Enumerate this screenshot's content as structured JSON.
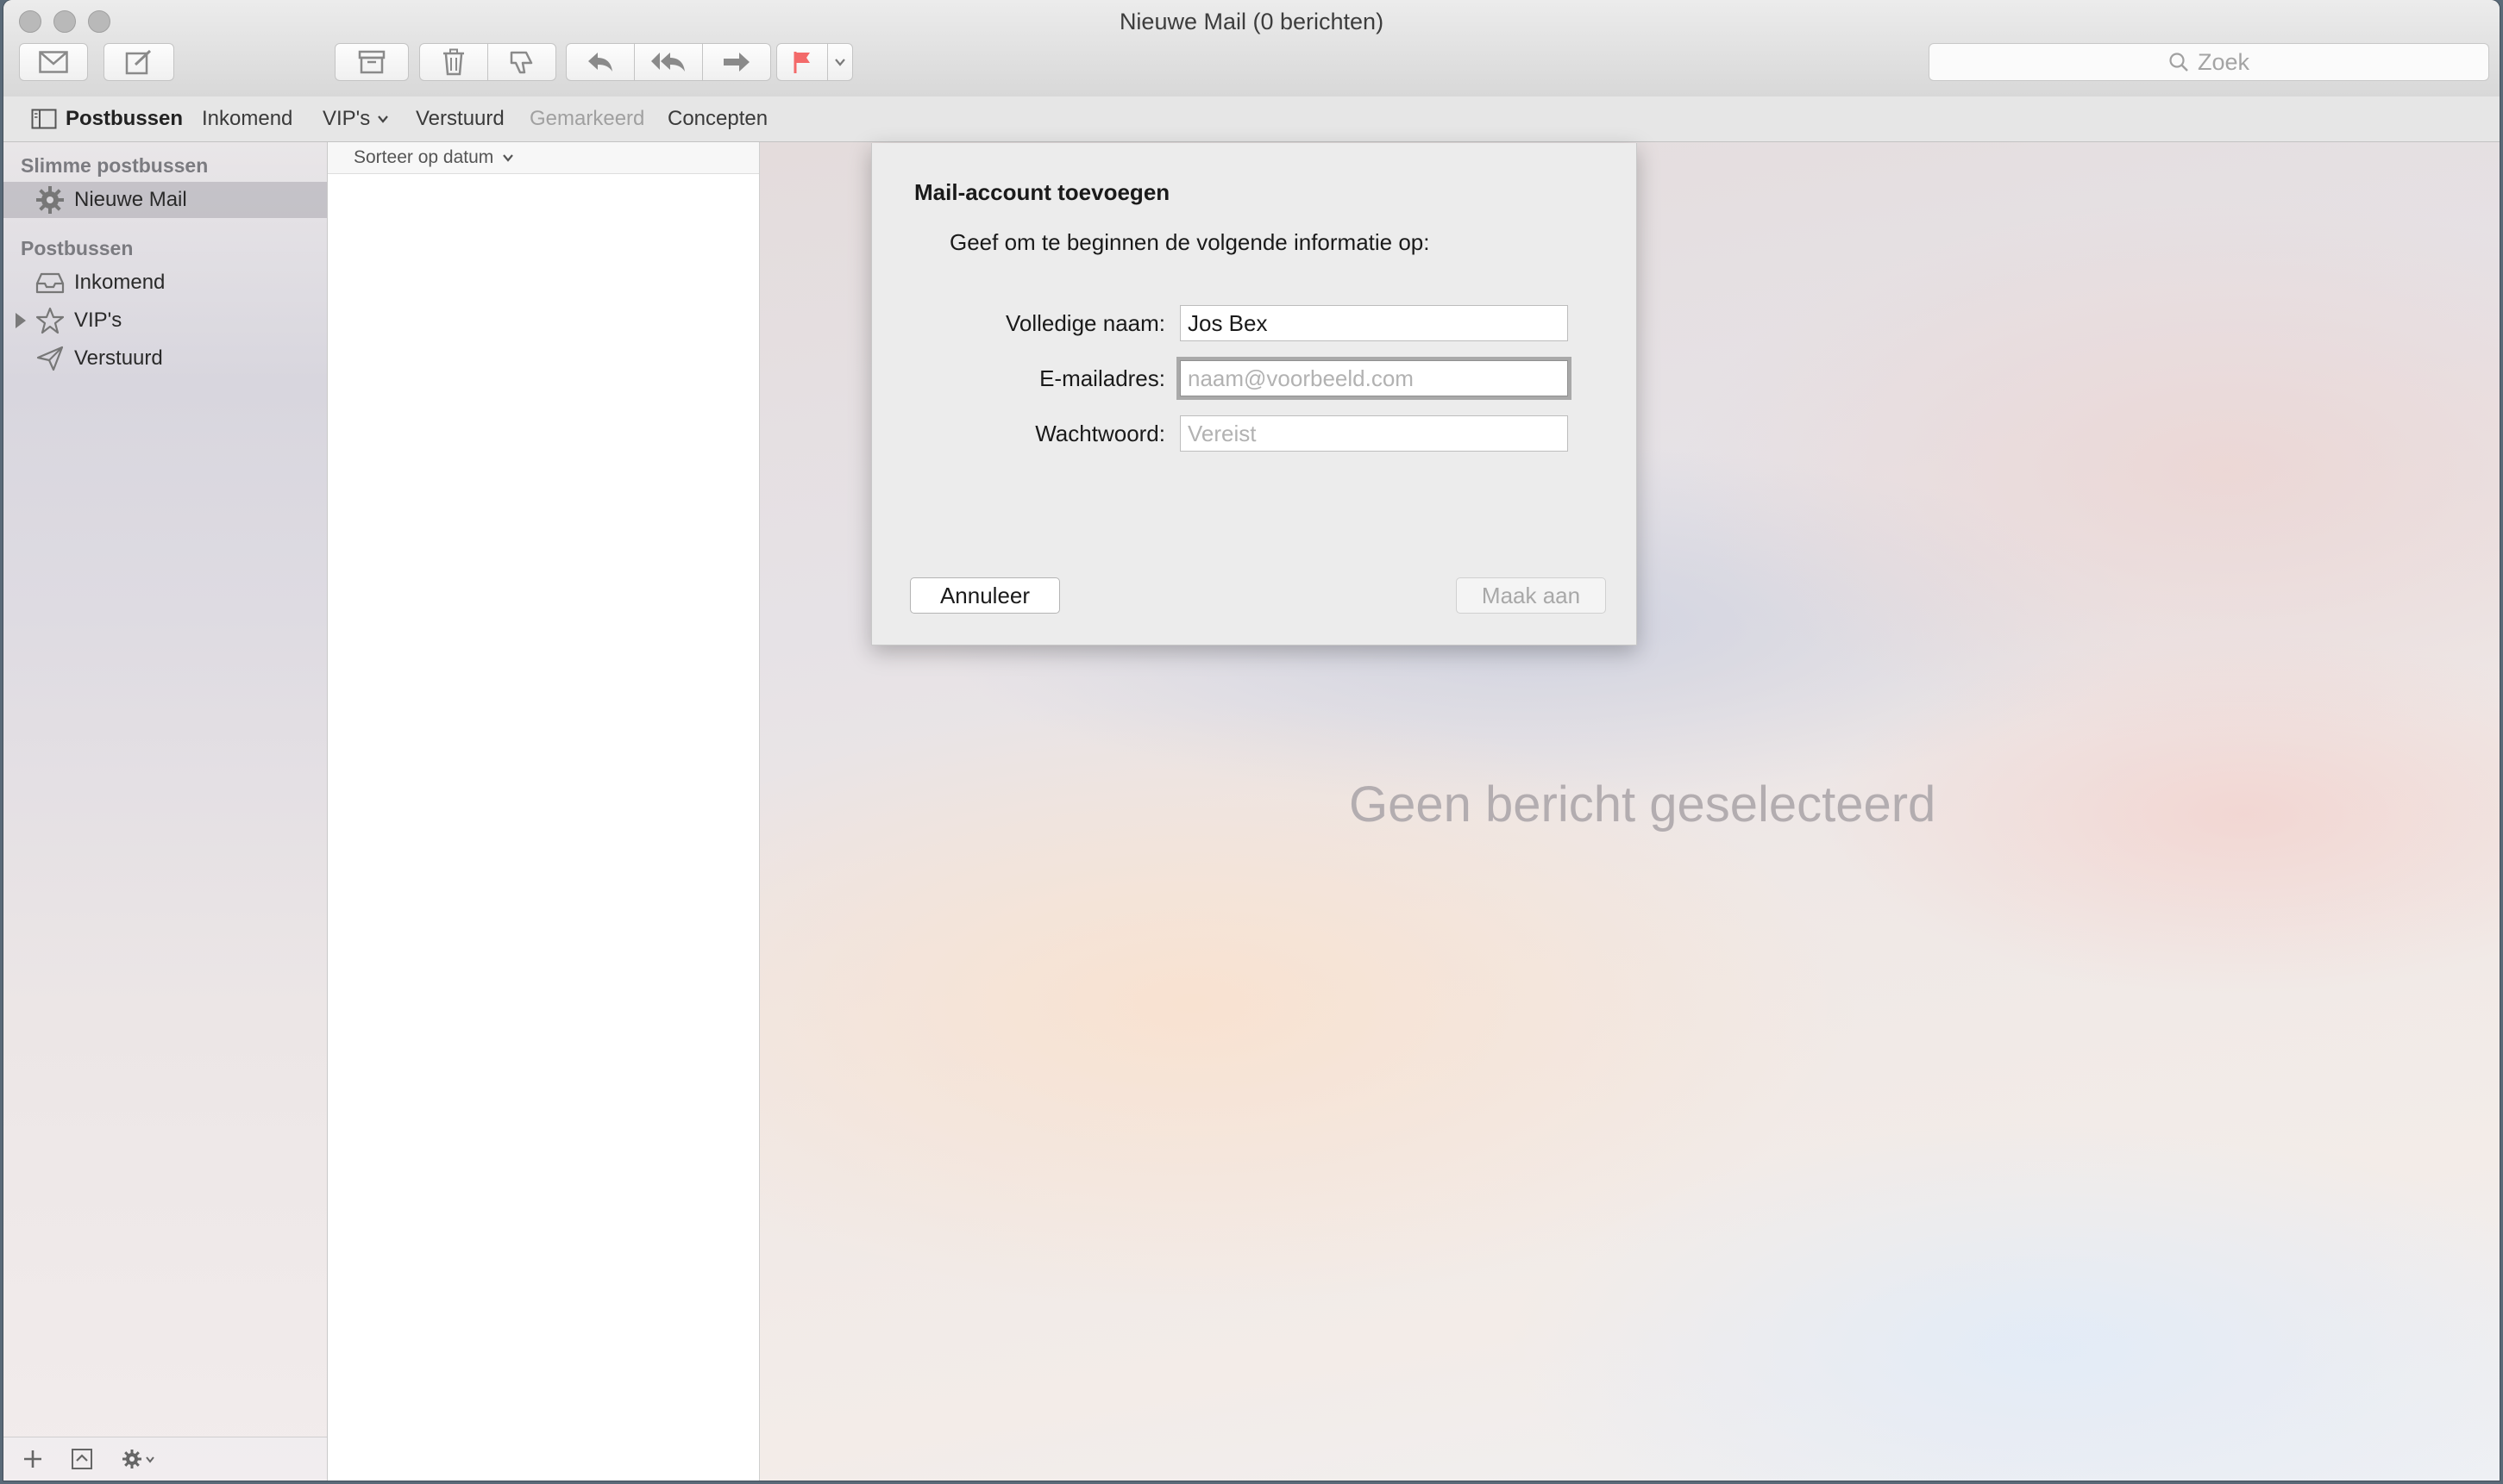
{
  "window": {
    "title": "Nieuwe Mail (0 berichten)"
  },
  "toolbar": {
    "buttons": [
      {
        "name": "get-mail",
        "icon": "envelope-icon"
      },
      {
        "name": "compose",
        "icon": "compose-icon"
      },
      {
        "name": "archive",
        "icon": "archive-icon"
      },
      {
        "name": "delete",
        "icon": "trash-icon"
      },
      {
        "name": "junk",
        "icon": "thumbs-down-icon"
      },
      {
        "name": "reply",
        "icon": "reply-icon"
      },
      {
        "name": "reply-all",
        "icon": "reply-all-icon"
      },
      {
        "name": "forward",
        "icon": "forward-icon"
      },
      {
        "name": "flag",
        "icon": "flag-icon"
      }
    ],
    "search_placeholder": "Zoek"
  },
  "favorites": {
    "mailboxes_label": "Postbussen",
    "items": [
      "Inkomend",
      "VIP's",
      "Verstuurd",
      "Gemarkeerd",
      "Concepten"
    ]
  },
  "sidebar": {
    "smart_header": "Slimme postbussen",
    "smart_items": [
      {
        "label": "Nieuwe Mail",
        "icon": "gear-icon"
      }
    ],
    "mailboxes_header": "Postbussen",
    "mailbox_items": [
      {
        "label": "Inkomend",
        "icon": "inbox-icon"
      },
      {
        "label": "VIP's",
        "icon": "star-icon"
      },
      {
        "label": "Verstuurd",
        "icon": "paper-plane-icon"
      }
    ]
  },
  "message_list": {
    "sort_label": "Sorteer op datum"
  },
  "preview": {
    "empty_text": "Geen bericht geselecteerd"
  },
  "dialog": {
    "title": "Mail-account toevoegen",
    "subtitle": "Geef om te beginnen de volgende informatie op:",
    "fields": [
      {
        "label": "Volledige naam:",
        "value": "Jos Bex",
        "placeholder": ""
      },
      {
        "label": "E-mailadres:",
        "value": "",
        "placeholder": "naam@voorbeeld.com"
      },
      {
        "label": "Wachtwoord:",
        "value": "",
        "placeholder": "Vereist"
      }
    ],
    "cancel_label": "Annuleer",
    "create_label": "Maak aan"
  },
  "colors": {
    "flag": "#f36a6a",
    "accent": "#7b7b80"
  }
}
